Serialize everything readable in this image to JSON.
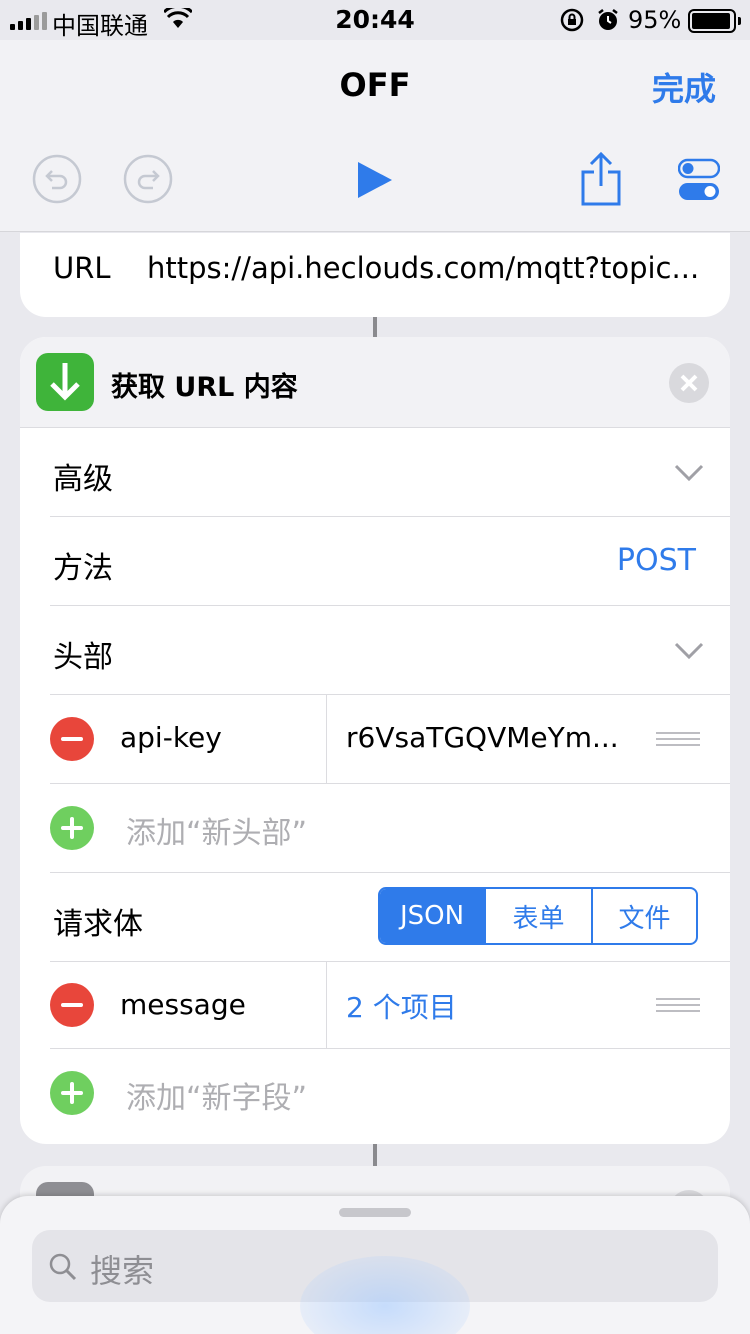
{
  "status_bar": {
    "carrier": "中国联通",
    "time": "20:44",
    "battery_pct": "95%",
    "battery_level": 0.95
  },
  "nav": {
    "title": "OFF",
    "done_label": "完成"
  },
  "toolbar": {
    "icons": [
      "undo-icon",
      "redo-icon",
      "play-icon",
      "share-icon",
      "settings-toggle-icon"
    ]
  },
  "url_card": {
    "label": "URL",
    "value": "https://api.heclouds.com/mqtt?topic..."
  },
  "action": {
    "title": "获取 URL 内容",
    "advanced_label": "高级",
    "method_label": "方法",
    "method_value": "POST",
    "headers_label": "头部",
    "header_rows": [
      {
        "key": "api-key",
        "value": "r6VsaTGQVMeYm..."
      }
    ],
    "add_header_placeholder": "添加“新头部”",
    "body_label": "请求体",
    "body_types": [
      "JSON",
      "表单",
      "文件"
    ],
    "body_type_selected": "JSON",
    "body_rows": [
      {
        "key": "message",
        "value": "2 个项目"
      }
    ],
    "add_field_placeholder": "添加“新字段”"
  },
  "search": {
    "placeholder": "搜索"
  },
  "colors": {
    "accent": "#2f7bea",
    "remove": "#e8463b",
    "add": "#6fcf5f",
    "action_icon_bg": "#3fb43a"
  }
}
